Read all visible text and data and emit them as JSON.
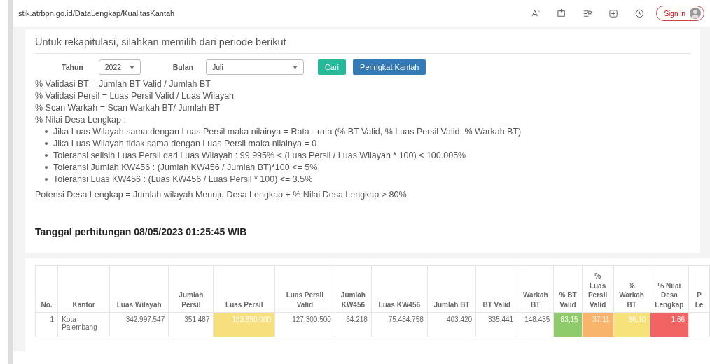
{
  "browser": {
    "url": "stik.atrbpn.go.id/DataLengkap/KualitasKantah",
    "sign_in": "Sign in"
  },
  "form": {
    "heading": "Untuk rekapitulasi, silahkan memilih dari periode berikut",
    "year_label": "Tahun",
    "year": "2022",
    "month_label": "Bulan",
    "month": "Juli",
    "buttons": [
      {
        "label": "Cari",
        "kind": "success"
      },
      {
        "label": "Peringkat Kantah",
        "kind": "primary"
      }
    ]
  },
  "notes": [
    "% Validasi BT = Jumlah BT Valid / Jumlah BT",
    "% Validasi Persil = Luas Persil Valid / Luas Wilayah",
    "% Scan Warkah = Scan Warkah BT/ Jumlah BT",
    "% Nilai Desa Lengkap :"
  ],
  "bullets": [
    "Jika Luas Wilayah sama dengan Luas Persil maka nilainya = Rata - rata (% BT Valid, % Luas Persil Valid, % Warkah BT)",
    "Jika Luas Wilayah tidak sama dengan Luas Persil maka nilainya = 0",
    "Toleransi selisih Luas Persil dari Luas Wilayah : 99.995% < (Luas Persil / Luas Wilayah * 100) < 100.005%",
    "Toleransi Jumlah KW456 : (Jumlah KW456 / Jumlah BT)*100 <= 5%",
    "Toleransi Luas KW456 : (Luas KW456 / Luas Persil * 100) <= 3.5%"
  ],
  "potensi": "Potensi Desa Lengkap = Jumlah wilayah Menuju Desa Lengkap + % Nilai Desa Lengkap > 80%",
  "calc_date": "Tanggal perhitungan 08/05/2023 01:25:45 WIB",
  "table": {
    "columns": [
      "No.",
      "Kantor",
      "Luas Wilayah",
      "Jumlah Persil",
      "Luas Persil",
      "Luas Persil Valid",
      "Jumlah KW456",
      "Luas KW456",
      "Jumlah BT",
      "BT Valid",
      "Warkah BT",
      "% BT Valid",
      "% Luas Persil Valid",
      "% Warkah BT",
      "% Nilai Desa Lengkap",
      "P Le"
    ],
    "rows": [
      [
        {
          "value": "1"
        },
        {
          "value": "Kota Palembang"
        },
        {
          "value": "342.997.547"
        },
        {
          "value": "351.487"
        },
        {
          "value": "183.850.000",
          "color": "#f7df7e"
        },
        {
          "value": "127.300.500"
        },
        {
          "value": "64.218"
        },
        {
          "value": "75.484.758"
        },
        {
          "value": "403.420"
        },
        {
          "value": "335.441"
        },
        {
          "value": "148.435"
        },
        {
          "value": "83,15",
          "color": "#8fcb6a"
        },
        {
          "value": "37,11",
          "color": "#f7b46a"
        },
        {
          "value": "56,10",
          "color": "#f7e27a"
        },
        {
          "value": "1,66",
          "color": "#f26464"
        }
      ]
    ]
  }
}
